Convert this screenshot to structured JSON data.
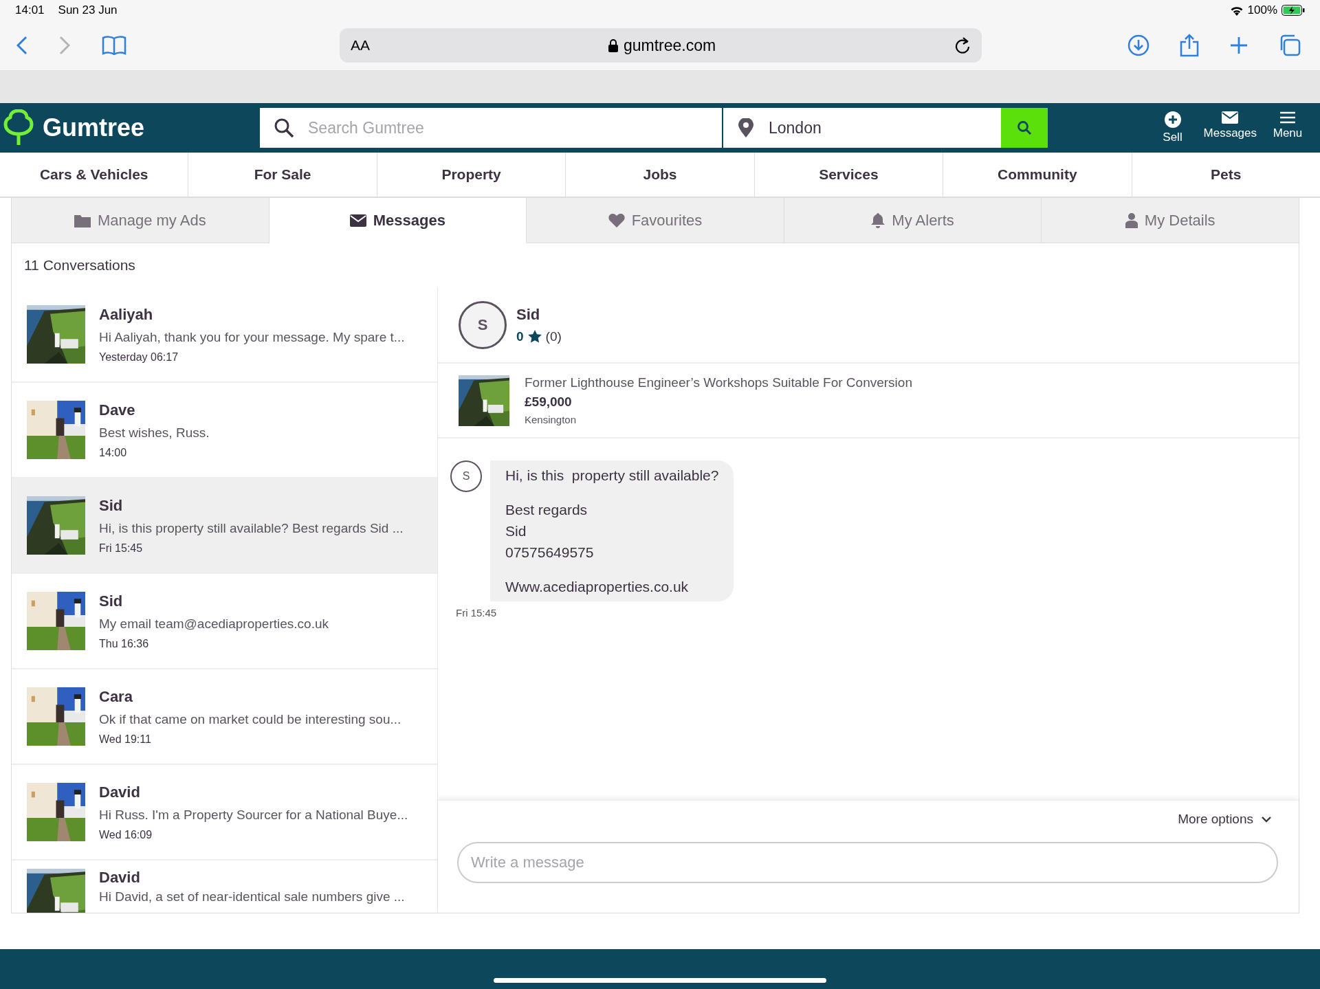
{
  "status_bar": {
    "time": "14:01",
    "date": "Sun 23 Jun",
    "battery": "100%"
  },
  "browser": {
    "text_size": "AA",
    "address": "gumtree.com",
    "forward_disabled": true
  },
  "header": {
    "logo": "Gumtree",
    "search": {
      "placeholder": "Search Gumtree"
    },
    "location": {
      "value": "London"
    },
    "actions": [
      {
        "kind": "sell",
        "label": "Sell"
      },
      {
        "kind": "messages",
        "label": "Messages"
      },
      {
        "kind": "menu",
        "label": "Menu"
      }
    ]
  },
  "categories": [
    "Cars & Vehicles",
    "For Sale",
    "Property",
    "Jobs",
    "Services",
    "Community",
    "Pets"
  ],
  "tabs": [
    {
      "kind": "folder",
      "label": "Manage my Ads",
      "selected": false
    },
    {
      "kind": "envelope",
      "label": "Messages",
      "selected": true
    },
    {
      "kind": "heart",
      "label": "Favourites",
      "selected": false
    },
    {
      "kind": "bell",
      "label": "My Alerts",
      "selected": false
    },
    {
      "kind": "person",
      "label": "My Details",
      "selected": false
    }
  ],
  "conversation_count": "11 Conversations",
  "conversations": [
    {
      "name": "Aaliyah",
      "preview": "Hi Aaliyah, thank you for your message. My spare t...",
      "time": "Yesterday 06:17",
      "selected": false
    },
    {
      "name": "Dave",
      "preview": "Best wishes, Russ.",
      "time": "14:00",
      "selected": false
    },
    {
      "name": "Sid",
      "preview": "Hi, is this property still available? Best regards Sid ...",
      "time": "Fri 15:45",
      "selected": true
    },
    {
      "name": "Sid",
      "preview": "My email team@acediaproperties.co.uk",
      "time": "Thu 16:36",
      "selected": false
    },
    {
      "name": "Cara",
      "preview": "Ok if that came on market could be interesting sou...",
      "time": "Wed 19:11",
      "selected": false
    },
    {
      "name": "David",
      "preview": "Hi Russ. I'm a Property Sourcer for a National Buye...",
      "time": "Wed 16:09",
      "selected": false
    },
    {
      "name": "David",
      "preview": "Hi David, a set of near-identical sale numbers give ..."
    }
  ],
  "chat": {
    "contact": {
      "initial": "S",
      "name": "Sid",
      "rating": "0",
      "reviews": "(0)"
    },
    "listing": {
      "title": "Former Lighthouse Engineer’s Workshops Suitable For Conversion",
      "price": "£59,000",
      "location": "Kensington"
    },
    "messages": [
      {
        "initial": "S",
        "paragraphs": [
          [
            "Hi, is this  property still available?"
          ],
          [
            "Best regards",
            "Sid",
            "07575649575"
          ],
          [
            "Www.acediaproperties.co.uk"
          ]
        ],
        "time": "Fri 15:45"
      }
    ],
    "more_options": "More options",
    "compose": {
      "placeholder": "Write a message"
    }
  }
}
